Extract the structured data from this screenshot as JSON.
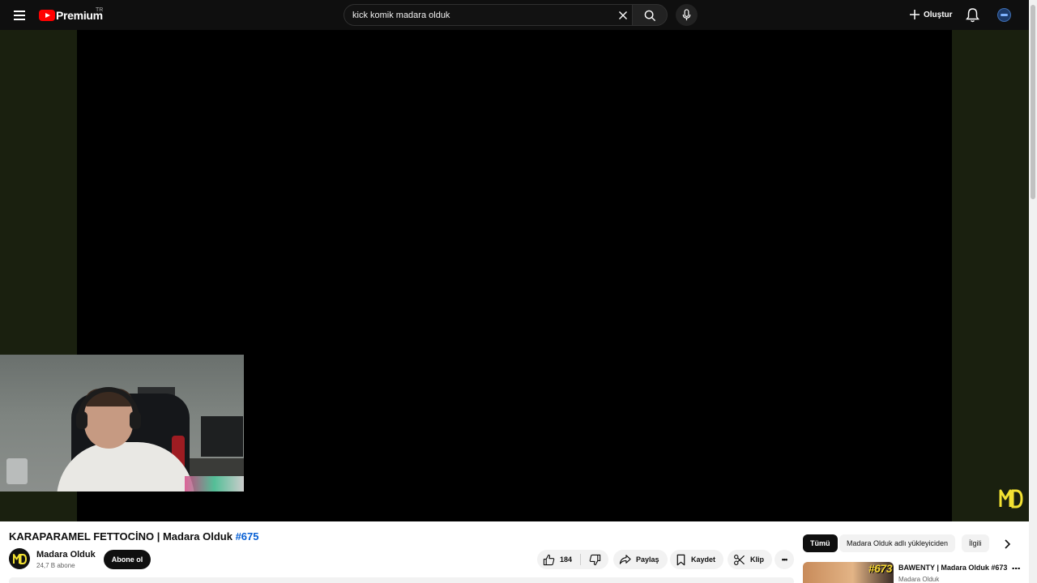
{
  "header": {
    "logo_text": "Premium",
    "country_code": "TR",
    "search_value": "kick komik madara olduk",
    "create_label": "Oluştur"
  },
  "icons": {
    "menu": "hamburger-icon",
    "search": "search-icon",
    "clear": "close-icon",
    "mic": "mic-icon",
    "create": "plus-icon",
    "notifications": "bell-icon",
    "like": "thumbs-up-icon",
    "dislike": "thumbs-down-icon",
    "share": "share-arrow-icon",
    "save": "bookmark-icon",
    "clip": "scissors-icon",
    "more": "more-horizontal-icon",
    "next": "chevron-right-icon"
  },
  "video": {
    "title": "KARAPARAMEL FETTOCİNO | Madara Olduk",
    "hashtag": "#675",
    "channel_name": "Madara Olduk",
    "subscribers": "24,7 B abone",
    "subscribe_label": "Abone ol",
    "like_count": "184",
    "share_label": "Paylaş",
    "save_label": "Kaydet",
    "clip_label": "Klip",
    "more_label": "•••"
  },
  "sidebar": {
    "chips": [
      "Tümü",
      "Madara Olduk adlı yükleyiciden",
      "İlgili"
    ],
    "active_chip": "Tümü",
    "recommendations": [
      {
        "title": "BAWENTY | Madara Olduk #673",
        "channel": "Madara Olduk",
        "thumb_badge": "#673",
        "more_label": "⋮"
      }
    ]
  },
  "colors": {
    "topbar": "#0f0f0f",
    "accent_red": "#ff0000",
    "hashtag_blue": "#065fd4",
    "player_side": "#1a200f",
    "watermark_yellow": "#f3e232"
  }
}
